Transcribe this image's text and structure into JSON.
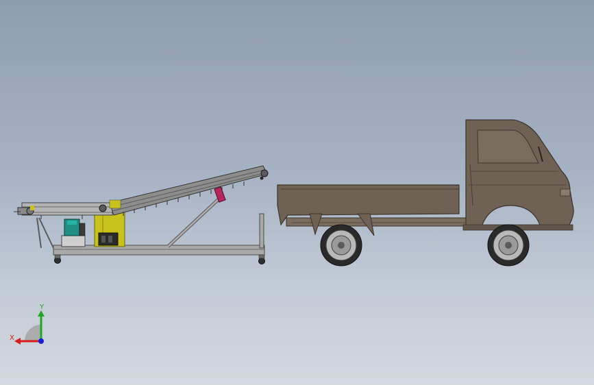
{
  "viewport": {
    "background_top": "#8e9db0",
    "background_bottom": "#d3d8df"
  },
  "triad": {
    "x_label": "X",
    "y_label": "Y",
    "x_color": "#d81b1b",
    "y_color": "#1fa71f",
    "z_color": "#1b1bd8"
  },
  "colors": {
    "truck_body": "#6f6254",
    "truck_outline": "#3a332b",
    "frame": "#a7a7a7",
    "hopper_yellow": "#c9c21b",
    "actuator": "#b8245e",
    "motor": "#1f8f84"
  }
}
